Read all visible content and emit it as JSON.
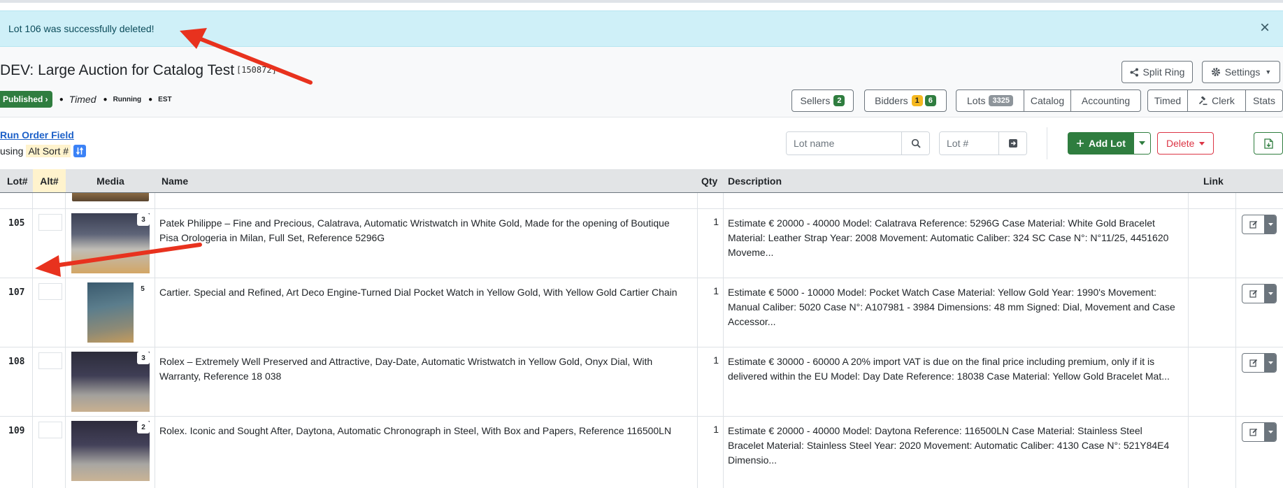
{
  "alert": {
    "message": "Lot 106 was successfully deleted!",
    "close_symbol": "×"
  },
  "header": {
    "title": "DEV: Large Auction for Catalog Test",
    "auction_id": "[150872]",
    "status": {
      "published": "Published",
      "timed": "Timed",
      "running": "Running",
      "timezone": "EST"
    },
    "buttons": {
      "split_ring": "Split Ring",
      "settings": "Settings"
    },
    "nav": {
      "sellers": {
        "label": "Sellers",
        "count": "2"
      },
      "bidders": {
        "label": "Bidders",
        "count_pending": "1",
        "count_approved": "6"
      },
      "lots": {
        "label": "Lots",
        "count": "3325"
      },
      "catalog": "Catalog",
      "accounting": "Accounting",
      "timed": "Timed",
      "clerk": "Clerk",
      "stats": "Stats"
    }
  },
  "toolbar": {
    "run_order_field": "Run Order Field",
    "using_prefix": "using",
    "sort_field": "Alt Sort #",
    "search": {
      "lot_name_placeholder": "Lot name",
      "lot_number_placeholder": "Lot #"
    },
    "add_lot": "Add Lot",
    "delete": "Delete"
  },
  "table": {
    "columns": {
      "lot": "Lot#",
      "alt": "Alt#",
      "media": "Media",
      "name": "Name",
      "qty": "Qty",
      "description": "Description",
      "link": "Link"
    },
    "rows": [
      {
        "lot": "105",
        "photos": "3",
        "name": "Patek Philippe – Fine and Precious, Calatrava, Automatic Wristwatch in White Gold, Made for the opening of Boutique Pisa Orologeria in Milan, Full Set, Reference 5296G",
        "qty": "1",
        "description": "Estimate € 20000 - 40000 Model: Calatrava Reference: 5296G Case Material: White Gold Bracelet Material: Leather Strap Year: 2008 Movement: Automatic Caliber: 324 SC Case N°: N°11/25, 4451620 Moveme..."
      },
      {
        "lot": "107",
        "photos": "5",
        "name": "Cartier. Special and Refined, Art Deco Engine-Turned Dial Pocket Watch in Yellow Gold, With Yellow Gold Cartier Chain",
        "qty": "1",
        "description": "Estimate € 5000 - 10000 Model: Pocket Watch Case Material: Yellow Gold Year: 1990's Movement: Manual Caliber: 5020 Case N°: A107981 - 3984 Dimensions: 48 mm Signed: Dial, Movement and Case Accessor..."
      },
      {
        "lot": "108",
        "photos": "3",
        "name": "Rolex – Extremely Well Preserved and Attractive, Day-Date, Automatic Wristwatch in Yellow Gold, Onyx Dial, With Warranty, Reference 18 038",
        "qty": "1",
        "description": "Estimate € 30000 - 60000 A 20% import VAT is due on the final price including premium, only if it is delivered within the EU Model: Day Date Reference: 18038 Case Material: Yellow Gold Bracelet Mat..."
      },
      {
        "lot": "109",
        "photos": "2",
        "name": "Rolex. Iconic and Sought After, Daytona, Automatic Chronograph in Steel, With Box and Papers, Reference 116500LN",
        "qty": "1",
        "description": "Estimate € 20000 - 40000 Model: Daytona Reference: 116500LN Case Material: Stainless Steel Bracelet Material: Stainless Steel Year: 2020 Movement: Automatic Caliber: 4130 Case N°: 521Y84E4 Dimensio..."
      }
    ]
  },
  "colors": {
    "alert_bg": "#cff0f8",
    "success": "#2f7d3f",
    "danger": "#dc3545",
    "warning": "#f5b820",
    "annotation_arrow": "#e8321e"
  },
  "icons": [
    "close-icon",
    "share-icon",
    "gear-icon",
    "search-icon",
    "arrow-right-icon",
    "plus-icon",
    "file-excel-icon",
    "edit-icon",
    "caret-down-icon",
    "sort-icon",
    "gavel-icon"
  ]
}
